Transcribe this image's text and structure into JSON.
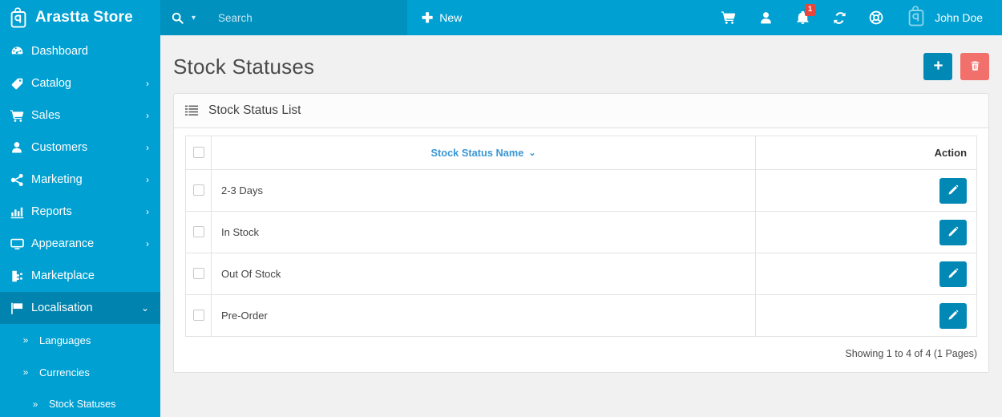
{
  "sidebar": {
    "brand": {
      "name": "Arastta Store",
      "logo_icon": "arastta-bag-logo"
    },
    "items": [
      {
        "label": "Dashboard",
        "icon": "dashboard-icon",
        "caret": "",
        "active": false
      },
      {
        "label": "Catalog",
        "icon": "tag-icon",
        "caret": "›",
        "active": false
      },
      {
        "label": "Sales",
        "icon": "cart-icon",
        "caret": "›",
        "active": false
      },
      {
        "label": "Customers",
        "icon": "user-icon",
        "caret": "›",
        "active": false
      },
      {
        "label": "Marketing",
        "icon": "share-icon",
        "caret": "›",
        "active": false
      },
      {
        "label": "Reports",
        "icon": "bar-chart-icon",
        "caret": "›",
        "active": false
      },
      {
        "label": "Appearance",
        "icon": "monitor-icon",
        "caret": "›",
        "active": false
      },
      {
        "label": "Marketplace",
        "icon": "plug-icon",
        "caret": "",
        "active": false
      },
      {
        "label": "Localisation",
        "icon": "flag-icon",
        "caret": "⌄",
        "active": true
      }
    ],
    "subitems": [
      {
        "label": "Languages",
        "chevron": "»",
        "deep": false
      },
      {
        "label": "Currencies",
        "chevron": "»",
        "deep": false
      },
      {
        "label": "Stock Statuses",
        "chevron": "»",
        "deep": true
      }
    ]
  },
  "topbar": {
    "search": {
      "placeholder": "Search",
      "value": "",
      "icon": "search-icon",
      "caret": "▾"
    },
    "new_button": {
      "label": "New",
      "plus": "✚"
    },
    "icons": [
      {
        "name": "cart-icon",
        "badge": ""
      },
      {
        "name": "user-icon",
        "badge": ""
      },
      {
        "name": "bell-icon",
        "badge": "1"
      },
      {
        "name": "refresh-icon",
        "badge": ""
      },
      {
        "name": "lifebuoy-icon",
        "badge": ""
      }
    ],
    "user": {
      "name": "John Doe",
      "avatar_icon": "arastta-bag-logo"
    }
  },
  "page": {
    "title": "Stock Statuses",
    "actions": [
      {
        "name": "add-button",
        "icon": "plus-icon",
        "color": "#0288b5"
      },
      {
        "name": "delete-button",
        "icon": "trash-icon",
        "color": "#f2706b"
      }
    ]
  },
  "panel": {
    "icon": "list-icon",
    "title": "Stock Status List",
    "table": {
      "columns": [
        {
          "key": "checkbox",
          "label": ""
        },
        {
          "key": "name",
          "label": "Stock Status Name",
          "sortable": true,
          "sort_caret": "⌄"
        },
        {
          "key": "action",
          "label": "Action"
        }
      ],
      "rows": [
        {
          "name": "2-3 Days",
          "checked": false,
          "action_icon": "pencil-icon"
        },
        {
          "name": "In Stock",
          "checked": false,
          "action_icon": "pencil-icon"
        },
        {
          "name": "Out Of Stock",
          "checked": false,
          "action_icon": "pencil-icon"
        },
        {
          "name": "Pre-Order",
          "checked": false,
          "action_icon": "pencil-icon"
        }
      ]
    },
    "footer_text": "Showing 1 to 4 of 4 (1 Pages)"
  },
  "colors": {
    "brand_blue": "#00a0d2",
    "brand_blue_dark": "#0083ae",
    "search_bg": "#0091bf",
    "accent_button": "#0288b5",
    "danger": "#f2706b",
    "badge_red": "#e8453c",
    "link_blue": "#3a97d4",
    "page_bg": "#f1f1f1"
  }
}
